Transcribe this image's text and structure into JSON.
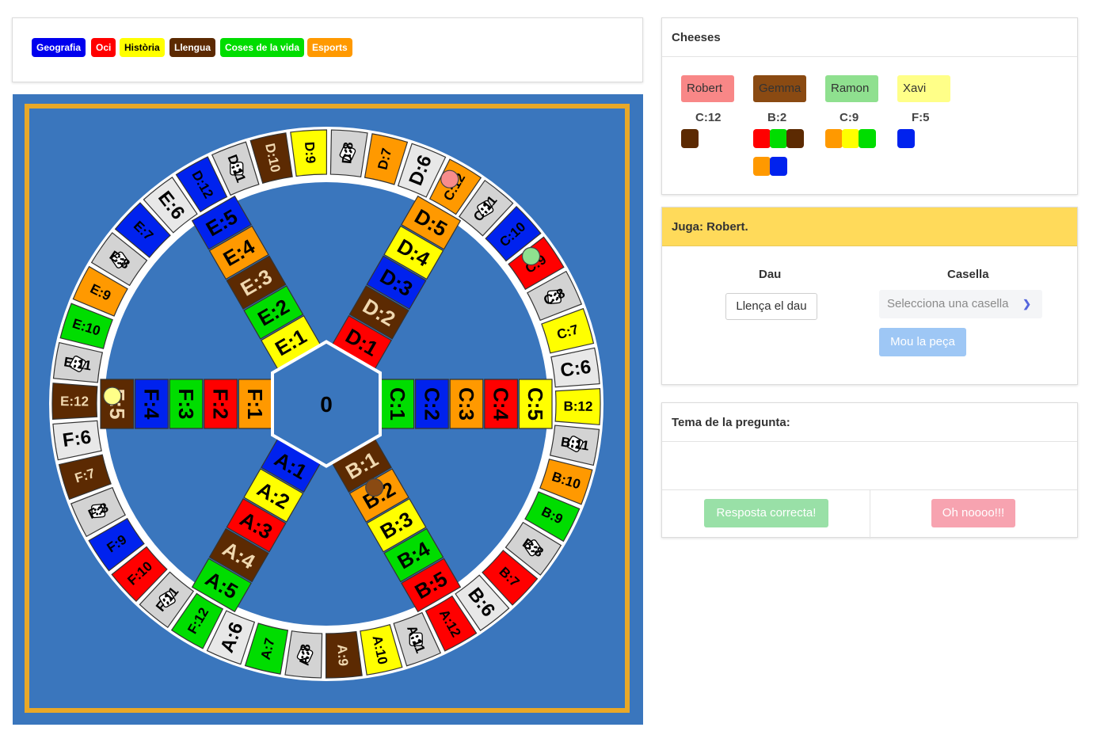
{
  "categories": [
    {
      "label": "Geografia",
      "bg": "#0000ee",
      "fg": "#ffffff"
    },
    {
      "label": "Oci",
      "bg": "#ff0000",
      "fg": "#ffffff"
    },
    {
      "label": "Història",
      "bg": "#ffff00",
      "fg": "#000000"
    },
    {
      "label": "Llengua",
      "bg": "#5c2a02",
      "fg": "#ffffff"
    },
    {
      "label": "Coses de la vida",
      "bg": "#00dd00",
      "fg": "#ffffff"
    },
    {
      "label": "Esports",
      "bg": "#ff9900",
      "fg": "#ffffff"
    }
  ],
  "colors": {
    "Geografia": "#0022ee",
    "Oci": "#ff0000",
    "Historia": "#ffff00",
    "Llengua": "#5c2a02",
    "CosesVida": "#00dd00",
    "Esports": "#ff9900",
    "Dice": "#d3d3d3",
    "Cheese": "#e8e8e8",
    "Board": "#3a76bd",
    "Frame": "#e8a828"
  },
  "board": {
    "center_label": "0",
    "ring_cells": [
      {
        "label": "A:6",
        "color": "Cheese"
      },
      {
        "label": "A:7",
        "color": "CosesVida"
      },
      {
        "label": "A:8",
        "color": "Dice"
      },
      {
        "label": "A:9",
        "color": "Llengua"
      },
      {
        "label": "A:10",
        "color": "Historia"
      },
      {
        "label": "A:11",
        "color": "Dice"
      },
      {
        "label": "A:12",
        "color": "Oci"
      },
      {
        "label": "B:6",
        "color": "Cheese"
      },
      {
        "label": "B:7",
        "color": "Oci"
      },
      {
        "label": "B:8",
        "color": "Dice"
      },
      {
        "label": "B:9",
        "color": "CosesVida"
      },
      {
        "label": "B:10",
        "color": "Esports"
      },
      {
        "label": "B:11",
        "color": "Dice"
      },
      {
        "label": "B:12",
        "color": "Historia"
      },
      {
        "label": "C:6",
        "color": "Cheese"
      },
      {
        "label": "C:7",
        "color": "Historia"
      },
      {
        "label": "C:8",
        "color": "Dice"
      },
      {
        "label": "C:9",
        "color": "Oci"
      },
      {
        "label": "C:10",
        "color": "Geografia"
      },
      {
        "label": "C:11",
        "color": "Dice"
      },
      {
        "label": "C:12",
        "color": "Esports"
      },
      {
        "label": "D:6",
        "color": "Cheese"
      },
      {
        "label": "D:7",
        "color": "Esports"
      },
      {
        "label": "D:8",
        "color": "Dice"
      },
      {
        "label": "D:9",
        "color": "Historia"
      },
      {
        "label": "D:10",
        "color": "Llengua"
      },
      {
        "label": "D:11",
        "color": "Dice"
      },
      {
        "label": "D:12",
        "color": "Geografia"
      },
      {
        "label": "E:6",
        "color": "Cheese"
      },
      {
        "label": "E:7",
        "color": "Geografia"
      },
      {
        "label": "E:8",
        "color": "Dice"
      },
      {
        "label": "E:9",
        "color": "Esports"
      },
      {
        "label": "E:10",
        "color": "CosesVida"
      },
      {
        "label": "E:11",
        "color": "Dice"
      },
      {
        "label": "E:12",
        "color": "Llengua"
      },
      {
        "label": "F:6",
        "color": "Cheese"
      },
      {
        "label": "F:7",
        "color": "Llengua"
      },
      {
        "label": "F:8",
        "color": "Dice"
      },
      {
        "label": "F:9",
        "color": "Geografia"
      },
      {
        "label": "F:10",
        "color": "Oci"
      },
      {
        "label": "F:11",
        "color": "Dice"
      },
      {
        "label": "F:12",
        "color": "CosesVida"
      }
    ],
    "spokes": [
      {
        "name": "C",
        "cells": [
          {
            "label": "C:1",
            "color": "CosesVida"
          },
          {
            "label": "C:2",
            "color": "Geografia"
          },
          {
            "label": "C:3",
            "color": "Esports"
          },
          {
            "label": "C:4",
            "color": "Oci"
          },
          {
            "label": "C:5",
            "color": "Historia"
          }
        ]
      },
      {
        "name": "B",
        "cells": [
          {
            "label": "B:1",
            "color": "Llengua"
          },
          {
            "label": "B:2",
            "color": "Esports"
          },
          {
            "label": "B:3",
            "color": "Historia"
          },
          {
            "label": "B:4",
            "color": "CosesVida"
          },
          {
            "label": "B:5",
            "color": "Oci"
          }
        ]
      },
      {
        "name": "A",
        "cells": [
          {
            "label": "A:1",
            "color": "Geografia"
          },
          {
            "label": "A:2",
            "color": "Historia"
          },
          {
            "label": "A:3",
            "color": "Oci"
          },
          {
            "label": "A:4",
            "color": "Llengua"
          },
          {
            "label": "A:5",
            "color": "CosesVida"
          }
        ]
      },
      {
        "name": "F",
        "cells": [
          {
            "label": "F:1",
            "color": "Esports"
          },
          {
            "label": "F:2",
            "color": "Oci"
          },
          {
            "label": "F:3",
            "color": "CosesVida"
          },
          {
            "label": "F:4",
            "color": "Geografia"
          },
          {
            "label": "F:5",
            "color": "Llengua"
          }
        ]
      },
      {
        "name": "E",
        "cells": [
          {
            "label": "E:1",
            "color": "Historia"
          },
          {
            "label": "E:2",
            "color": "CosesVida"
          },
          {
            "label": "E:3",
            "color": "Llengua"
          },
          {
            "label": "E:4",
            "color": "Esports"
          },
          {
            "label": "E:5",
            "color": "Geografia"
          }
        ]
      },
      {
        "name": "D",
        "cells": [
          {
            "label": "D:1",
            "color": "Oci"
          },
          {
            "label": "D:2",
            "color": "Llengua"
          },
          {
            "label": "D:3",
            "color": "Geografia"
          },
          {
            "label": "D:4",
            "color": "Historia"
          },
          {
            "label": "D:5",
            "color": "Esports"
          }
        ]
      }
    ],
    "pieces": [
      {
        "player": "Robert",
        "cell": "C:12",
        "color": "#f78c8c"
      },
      {
        "player": "Gemma",
        "cell": "B:2",
        "color": "#8a4a12"
      },
      {
        "player": "Ramon",
        "cell": "C:9",
        "color": "#8fe08f"
      },
      {
        "player": "Xavi",
        "cell": "F:5",
        "color": "#ffff88"
      }
    ]
  },
  "cheeses": {
    "title": "Cheeses",
    "players": [
      {
        "name": "Robert",
        "color": "#f88787",
        "position": "C:12",
        "chips": [
          "#5c2a02"
        ]
      },
      {
        "name": "Gemma",
        "color": "#8a4a12",
        "position": "B:2",
        "chips": [
          "#ff0000",
          "#00dd00",
          "#5c2a02",
          "#ff9900",
          "#0022ee"
        ]
      },
      {
        "name": "Ramon",
        "color": "#8fe08f",
        "position": "C:9",
        "chips": [
          "#ff9900",
          "#ffff00",
          "#00dd00"
        ]
      },
      {
        "name": "Xavi",
        "color": "#ffff88",
        "position": "F:5",
        "chips": [
          "#0022ee"
        ]
      }
    ]
  },
  "turn": {
    "title": "Juga: Robert.",
    "dice_label": "Dau",
    "roll_button": "Llença el dau",
    "cell_label": "Casella",
    "select_placeholder": "Selecciona una casella",
    "move_button": "Mou la peça"
  },
  "question": {
    "title": "Tema de la pregunta:",
    "correct_button": "Resposta correcta!",
    "wrong_button": "Oh noooo!!!"
  }
}
